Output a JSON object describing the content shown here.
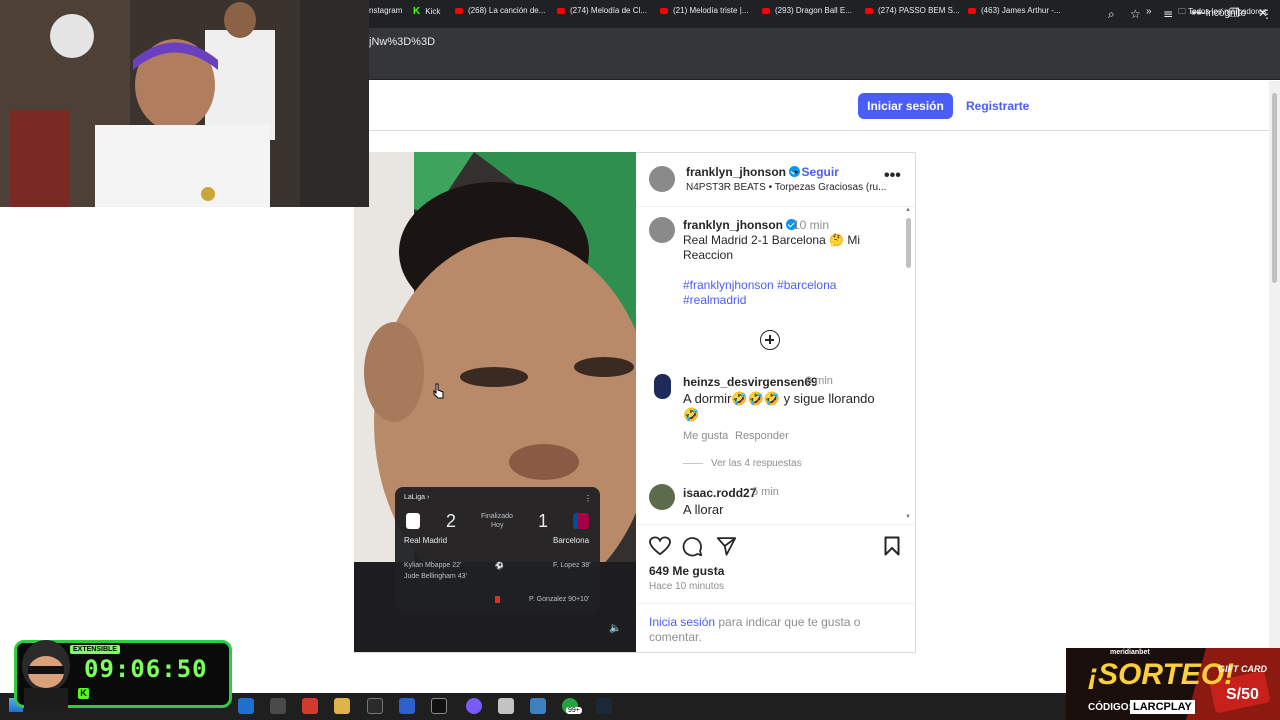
{
  "browser": {
    "url": "jNw%3D%3D",
    "incognito_label": "Incógnito",
    "bookmarks": [
      {
        "label": "nstagram",
        "type": "plain"
      },
      {
        "label": "Kick",
        "type": "kick"
      },
      {
        "label": "(268) La canción de...",
        "type": "yt"
      },
      {
        "label": "(274) Melodía de Cl...",
        "type": "yt"
      },
      {
        "label": "(21) Melodía triste |...",
        "type": "yt"
      },
      {
        "label": "(293) Dragon Ball E...",
        "type": "yt"
      },
      {
        "label": "(274) PASSO BEM S...",
        "type": "yt"
      },
      {
        "label": "(463) James Arthur -...",
        "type": "yt"
      }
    ],
    "all_bookmarks": "Todos los marcadores"
  },
  "nav": {
    "login": "Iniciar sesión",
    "register": "Registrarte"
  },
  "post": {
    "author": "franklyn_jhonson",
    "follow": "Seguir",
    "audio": "N4PST3R BEATS • Torpezas Graciosas (ru...",
    "caption_time": "10 min",
    "caption_line1": "Real Madrid 2-1 Barcelona 🤔 Mi",
    "caption_line2": "Reaccion",
    "hashtags_line1": "#franklynjhonson #barcelona",
    "hashtags_line2": "#realmadrid",
    "comments": [
      {
        "user": "heinzs_desvirgensen69",
        "time": "8 min",
        "text_line1": "A dormir🤣🤣🤣 y sigue llorando",
        "text_line2": "🤣",
        "like": "Me gusta",
        "reply": "Responder",
        "view_replies": "Ver las 4 respuestas"
      },
      {
        "user": "isaac.rodd27",
        "time": "5 min",
        "text_line1": "A llorar"
      }
    ],
    "likes": "649 Me gusta",
    "posted": "Hace 10 minutos",
    "login_prompt_link": "Inicia sesión",
    "login_prompt_rest": " para indicar que te gusta o",
    "login_prompt_line2": "comentar."
  },
  "scorecard": {
    "league": "LaLiga ›",
    "home": "Real Madrid",
    "home_score": "2",
    "status": "Finalizado",
    "when": "Hoy",
    "away_score": "1",
    "away": "Barcelona",
    "scorer1": "Kylian Mbappe 22'",
    "scorer2": "Jude Bellingham 43'",
    "away_scorer": "F. Lopez 38'",
    "card": "P. Gonzalez 90+10'"
  },
  "overlay": {
    "timer": "09:06:50",
    "extensible": "EXTENSIBLE",
    "promo_brand": "meridianbet",
    "promo_title": "¡SORTEO!",
    "promo_code_label": "CÓDIGO:",
    "promo_code": "LARCPLAY",
    "gift_card": "GIFT CARD",
    "gift_amount": "S/50"
  },
  "taskbar": {
    "badge": "99+"
  },
  "colors": {
    "accent": "#4a5df9",
    "timer_green": "#7dff5e"
  }
}
